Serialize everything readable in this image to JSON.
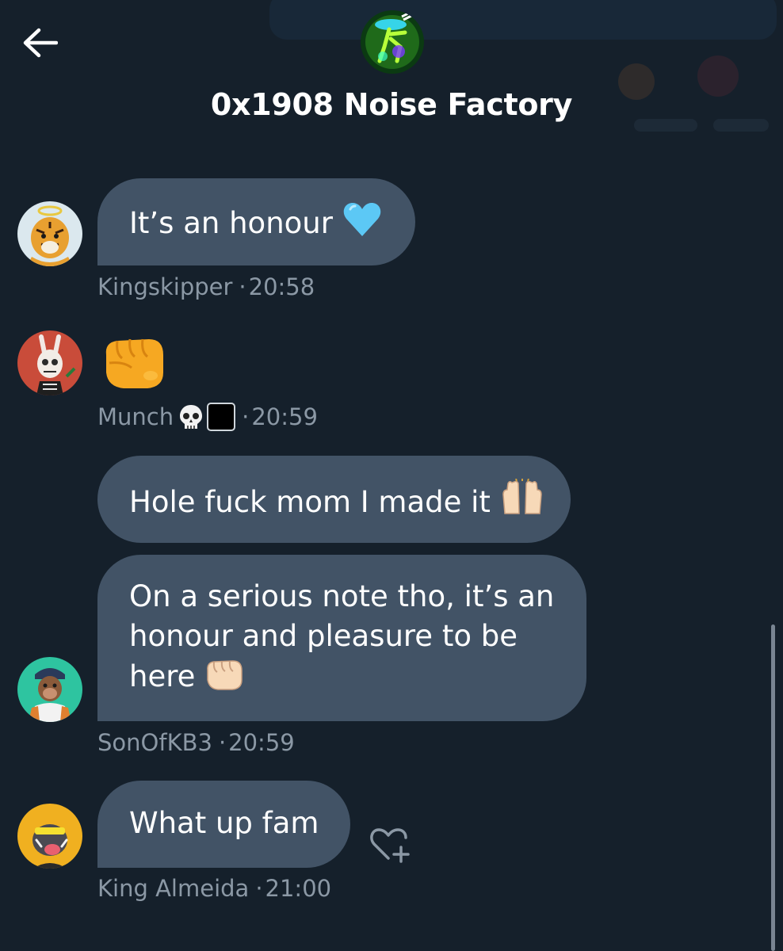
{
  "header": {
    "title": "0x1908 Noise Factory"
  },
  "messages": [
    {
      "text": "It’s an honour",
      "emoji": "light-blue-heart",
      "sender": "Kingskipper",
      "time": "20:58"
    },
    {
      "emoji": "oncoming-fist",
      "sender": "Munch",
      "sender_emojis": [
        "skull",
        "black-square"
      ],
      "time": "20:59"
    },
    {
      "text": "Hole fuck mom I made it",
      "emoji": "raising-hands"
    },
    {
      "text": "On a serious note tho, it’s an honour and pleasure to be here",
      "emoji": "oncoming-fist-light",
      "sender": "SonOfKB3",
      "time": "20:59"
    },
    {
      "text": "What up fam",
      "sender": "King Almeida",
      "time": "21:00"
    }
  ],
  "colors": {
    "background": "#15202b",
    "bubble": "#425366",
    "meta_text": "#8b98a5"
  }
}
